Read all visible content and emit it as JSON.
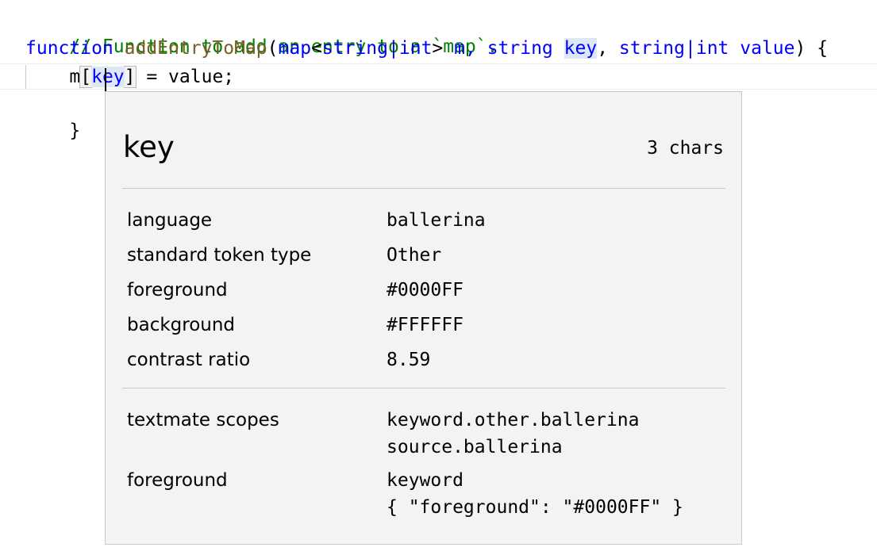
{
  "code": {
    "comment": "// Function to add an entry to a `map`.",
    "sig_function": "function",
    "sig_name": "addEntryToMap",
    "sig_open": "(",
    "sig_map": "map",
    "sig_lt": "<",
    "sig_string1": "string",
    "sig_pipe1": "|",
    "sig_int1": "int",
    "sig_gt": ">",
    "sig_m": " m,",
    "sig_string2": "string",
    "sig_key": "key",
    "sig_comma": ",",
    "sig_string3": "string",
    "sig_pipe2": "|",
    "sig_int2": "int",
    "sig_value": "value",
    "sig_close": ") {",
    "body_indent": "    m",
    "body_lbracket": "[",
    "body_key": "key",
    "body_rbracket": "]",
    "body_rest": " = value;",
    "closing_brace": "}"
  },
  "hover": {
    "title": "key",
    "length": "3 chars",
    "rows": [
      {
        "label": "language",
        "value": "ballerina"
      },
      {
        "label": "standard token type",
        "value": "Other"
      },
      {
        "label": "foreground",
        "value": "#0000FF"
      },
      {
        "label": "background",
        "value": "#FFFFFF"
      },
      {
        "label": "contrast ratio",
        "value": "8.59"
      }
    ],
    "scopes_label": "textmate scopes",
    "scopes": [
      "keyword.other.ballerina",
      "source.ballerina"
    ],
    "theme_label": "foreground",
    "theme_rule": [
      "keyword",
      "{ \"foreground\": \"#0000FF\" }"
    ]
  },
  "colors": {
    "comment": "#008000",
    "keyword": "#0000ff",
    "function": "#795e26",
    "hover_bg": "#f3f3f3"
  }
}
